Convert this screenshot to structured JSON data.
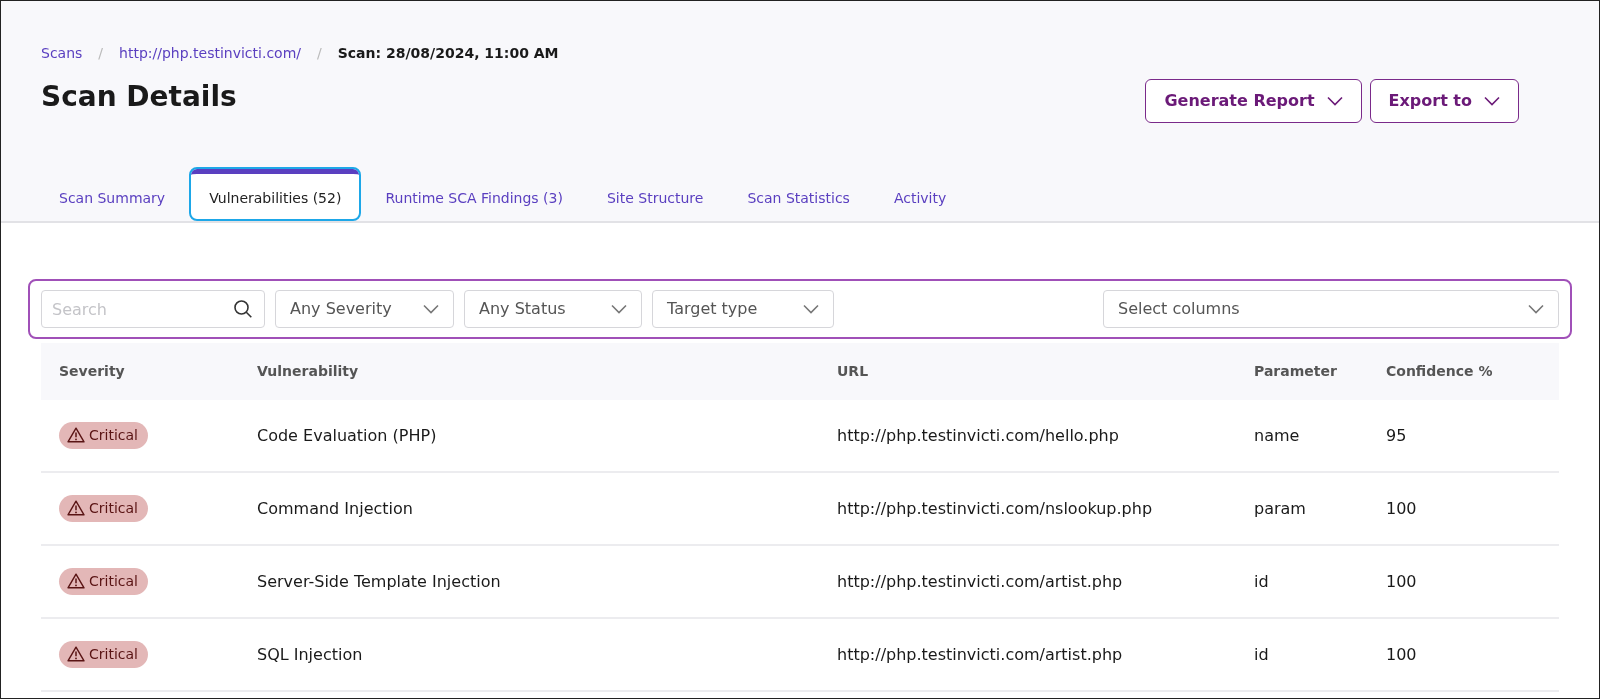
{
  "breadcrumb": [
    {
      "label": "Scans",
      "kind": "link"
    },
    {
      "label": "/",
      "kind": "separator"
    },
    {
      "label": "http://php.testinvicti.com/",
      "kind": "link"
    },
    {
      "label": "/",
      "kind": "separator"
    },
    {
      "label": "Scan: 28/08/2024, 11:00 AM",
      "kind": "current"
    }
  ],
  "title": "Scan Details",
  "actions": [
    {
      "label": "Generate Report"
    },
    {
      "label": "Export to"
    }
  ],
  "tabs": [
    {
      "label": "Scan Summary",
      "selected": false
    },
    {
      "label": "Vulnerabilities (52)",
      "selected": true
    },
    {
      "label": "Runtime SCA Findings (3)",
      "selected": false
    },
    {
      "label": "Site Structure",
      "selected": false
    },
    {
      "label": "Scan Statistics",
      "selected": false
    },
    {
      "label": "Activity",
      "selected": false
    }
  ],
  "filters": {
    "search": {
      "placeholder": "Search"
    },
    "dropdowns": [
      {
        "value": "Any Severity"
      },
      {
        "value": "Any Status"
      },
      {
        "value": "Target type"
      }
    ],
    "columns_select": {
      "placeholder": "Select columns"
    }
  },
  "table": {
    "columns": [
      "Severity",
      "Vulnerability",
      "URL",
      "Parameter",
      "Confidence %"
    ],
    "rows": [
      {
        "severity": "Critical",
        "vulnerability": "Code Evaluation (PHP)",
        "url": "http://php.testinvicti.com/hello.php",
        "parameter": "name",
        "confidence": "95"
      },
      {
        "severity": "Critical",
        "vulnerability": "Command Injection",
        "url": "http://php.testinvicti.com/nslookup.php",
        "parameter": "param",
        "confidence": "100"
      },
      {
        "severity": "Critical",
        "vulnerability": "Server-Side Template Injection",
        "url": "http://php.testinvicti.com/artist.php",
        "parameter": "id",
        "confidence": "100"
      },
      {
        "severity": "Critical",
        "vulnerability": "SQL Injection",
        "url": "http://php.testinvicti.com/artist.php",
        "parameter": "id",
        "confidence": "100"
      }
    ]
  }
}
